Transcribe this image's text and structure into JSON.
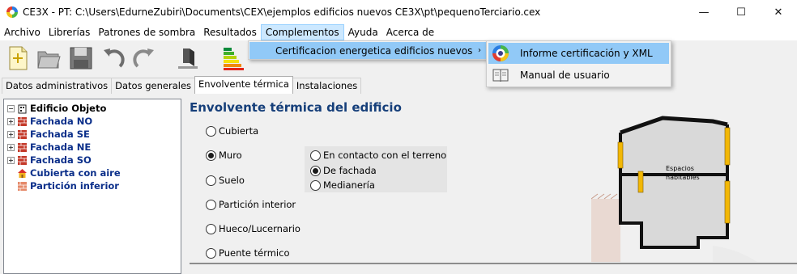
{
  "window": {
    "title": "CE3X - PT: C:\\Users\\EdurneZubiri\\Documents\\CEX\\ejemplos edificios nuevos CE3X\\pt\\pequenoTerciario.cex",
    "minimize": "—",
    "maximize": "☐",
    "close": "✕"
  },
  "menu": [
    "Archivo",
    "Librerías",
    "Patrones de sombra",
    "Resultados",
    "Complementos",
    "Ayuda",
    "Acerca de"
  ],
  "submenu": {
    "item": "Certificacion energetica edificios nuevos",
    "arrow": "›",
    "children": [
      "Informe certificación y XML",
      "Manual de usuario"
    ]
  },
  "tabs": [
    "Datos administrativos",
    "Datos generales",
    "Envolvente térmica",
    "Instalaciones"
  ],
  "tree": {
    "root": "Edificio Objeto",
    "items": [
      "Fachada NO",
      "Fachada SE",
      "Fachada NE",
      "Fachada SO",
      "Cubierta con aire",
      "Partición inferior"
    ]
  },
  "content": {
    "title": "Envolvente térmica del edificio",
    "options": [
      "Cubierta",
      "Muro",
      "Suelo",
      "Partición interior",
      "Hueco/Lucernario",
      "Puente térmico"
    ],
    "selected": "Muro",
    "muro_types": [
      "En contacto con el terreno",
      "De fachada",
      "Medianería"
    ],
    "muro_selected": "De fachada",
    "diagram_label_1": "Espacios",
    "diagram_label_2": "habitables"
  },
  "colors": {
    "accent": "#163f7a",
    "tree_text": "#0b2f8a",
    "highlight": "#91c9f7",
    "diagram_yellow": "#f2b705"
  }
}
